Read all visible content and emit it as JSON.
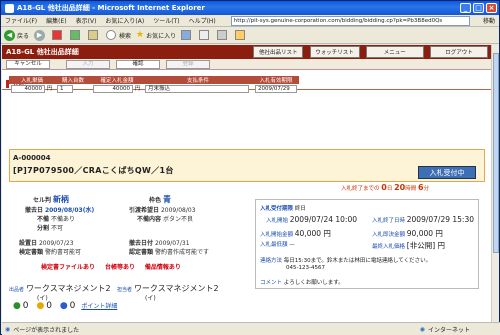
{
  "window": {
    "title": "A18-GL 他社出品詳細 - Microsoft Internet Explorer"
  },
  "menu": [
    "ファイル(F)",
    "編集(E)",
    "表示(V)",
    "お気に入り(A)",
    "ツール(T)",
    "ヘルプ(H)"
  ],
  "address": "http://pit-sys.genuine-corporation.com/bidding/bidding.cp?pk=Pb3B8ed0Qs",
  "go_label": "移動",
  "toolbar": {
    "back": "戻る",
    "search": "検索",
    "favorites": "お気に入り"
  },
  "app": {
    "title": "A18-GL 他社出品詳細",
    "nav": [
      "他社出品リスト",
      "ウォッチリスト",
      "メニュー",
      "ログアウト"
    ],
    "actions": {
      "cancel": "キャンセル",
      "input": "入力",
      "confirm": "確認",
      "register": "登録"
    }
  },
  "bid": {
    "section": "入札",
    "headers": [
      "入札単価",
      "購入台数",
      "確定入札金額",
      "支払条件",
      "入札有効期限"
    ],
    "unit_price": "40000",
    "unit_yen": "円",
    "quantity": "1",
    "total": "40000",
    "total_yen": "円",
    "payment": "月末振込",
    "expiry": "2009/07/29"
  },
  "item": {
    "code": "A-000004",
    "name": "[P]7P079500／CRAこくぱちQW／1台",
    "status": "入札受付中"
  },
  "remaining": {
    "label": "入札終了までの",
    "days": "0",
    "days_u": "日",
    "hours": "20",
    "hours_u": "時間",
    "mins": "6",
    "mins_u": "分"
  },
  "details": {
    "cell_label": "セル判",
    "cell_value": "新柄",
    "color_label": "枠色",
    "color_value": "青",
    "install_label": "撤去日",
    "install_value": "2009/08/03(水)",
    "delivery_label": "引渡希望日",
    "delivery_value": "2009/08/03",
    "defect_label": "不備",
    "defect_value": "不備あり",
    "defect_detail_label": "不備内容",
    "defect_detail_value": "ボタン不良",
    "split_label": "分割",
    "split_value": "不可",
    "setup_label": "設置日",
    "setup_value": "2009/07/23",
    "release_label": "撤去日付",
    "release_value": "2009/07/31",
    "insp_label": "検定書類",
    "insp_value": "警約書可能可",
    "approval_label": "認定書類",
    "approval_value": "警約書作成可能です",
    "link1": "検定書ファイルあり",
    "link2": "台帳等あり",
    "link3": "備品情報あり"
  },
  "info": {
    "end_label": "入札受付期限",
    "end_value": "終日",
    "start_label": "入札開始",
    "start_value": "2009/07/24 10:00",
    "close_label": "入札終了日時",
    "close_value": "2009/07/29 15:30",
    "cur_label": "入札開始金額",
    "cur_value": "40,000 円",
    "min_label": "入札即決金額",
    "min_value": "90,000 円",
    "max_label": "入札最低額",
    "max_value": "—",
    "flag_label": "最終入札価格",
    "flag_value": "[非公開] 円",
    "contact_label": "連絡方法",
    "contact_value": "毎日15:30まで。鈴木または林田に電話連絡してください。",
    "phone": "045-123-4567",
    "comment_label": "コメント",
    "comment_value": "よろしくお願いします。"
  },
  "seller": {
    "label1": "出品者",
    "label2": "担当者",
    "name1": "ワークスマネジメント2",
    "name2": "ワークスマネジメント2",
    "sub": "(イ)",
    "sub2": "(イ)",
    "score_a": "0",
    "score_b": "0",
    "score_c": "0",
    "points": "ポイント詳細"
  },
  "statusbar": {
    "left": "ページが表示されました",
    "right": "インターネット"
  }
}
